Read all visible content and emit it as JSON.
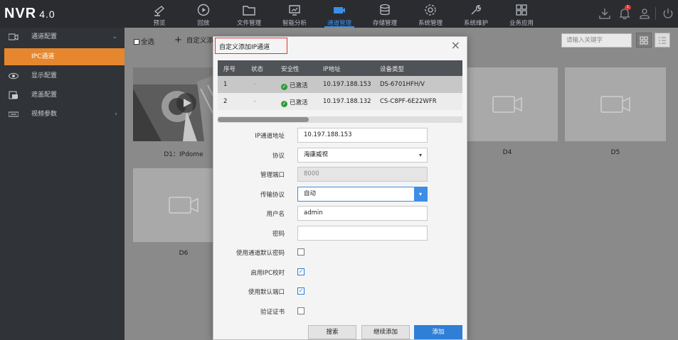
{
  "app": {
    "logo": "NVR",
    "version": "4.0"
  },
  "nav": [
    {
      "label": "预览",
      "icon": "camera-icon"
    },
    {
      "label": "回放",
      "icon": "playback-icon"
    },
    {
      "label": "文件管理",
      "icon": "folder-icon"
    },
    {
      "label": "智能分析",
      "icon": "analysis-icon"
    },
    {
      "label": "通道管理",
      "icon": "channel-icon"
    },
    {
      "label": "存储管理",
      "icon": "storage-icon"
    },
    {
      "label": "系统管理",
      "icon": "gear-icon"
    },
    {
      "label": "系统维护",
      "icon": "wrench-icon"
    },
    {
      "label": "业务应用",
      "icon": "apps-icon"
    }
  ],
  "topright": {
    "badge": "1"
  },
  "sidebar": {
    "items": [
      {
        "label": "通道配置",
        "arrow": "⌄"
      },
      {
        "label": "IPC通道"
      },
      {
        "label": "显示配置"
      },
      {
        "label": "遮盖配置"
      },
      {
        "label": "视频参数",
        "arrow": "›"
      }
    ]
  },
  "toolbar": {
    "select_all": "全选",
    "add_custom": "自定义添",
    "search_placeholder": "请输入关键字"
  },
  "cards": [
    {
      "label": "D1：IPdome"
    },
    {
      "label": "D4"
    },
    {
      "label": "D5"
    },
    {
      "label": "D6"
    }
  ],
  "dialog": {
    "title": "自定义添加IP通道",
    "close": "×",
    "columns": [
      "序号",
      "状态",
      "安全性",
      "IP地址",
      "设备类型"
    ],
    "rows": [
      {
        "no": "1",
        "status": "–",
        "security": "已激活",
        "ip": "10.197.188.153",
        "type": "DS-6701HFH/V"
      },
      {
        "no": "2",
        "status": "–",
        "security": "已激活",
        "ip": "10.197.188.132",
        "type": "CS-C8PF-6E22WFR"
      }
    ],
    "form": {
      "ip_label": "IP通道地址",
      "ip_value": "10.197.188.153",
      "protocol_label": "协议",
      "protocol_value": "海康威视",
      "port_label": "管理端口",
      "port_value": "8000",
      "transport_label": "传输协议",
      "transport_value": "自动",
      "user_label": "用户名",
      "user_value": "admin",
      "password_label": "密码",
      "password_value": "",
      "default_pwd_label": "使用通道默认密码",
      "ipc_time_label": "启用IPC校时",
      "default_port_label": "使用默认端口",
      "verify_cert_label": "验证证书"
    },
    "buttons": {
      "search": "搜索",
      "continue": "继续添加",
      "add": "添加"
    }
  }
}
